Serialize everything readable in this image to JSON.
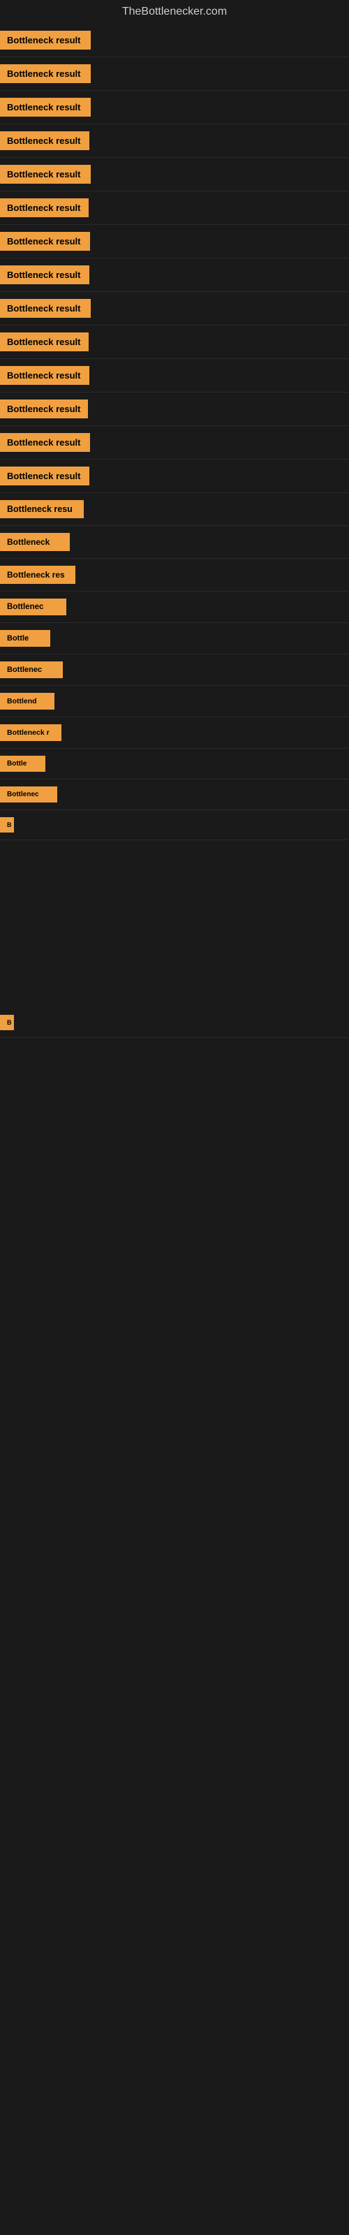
{
  "site": {
    "title": "TheBottlenecker.com"
  },
  "rows": [
    {
      "id": 1,
      "label": "Bottleneck result"
    },
    {
      "id": 2,
      "label": "Bottleneck result"
    },
    {
      "id": 3,
      "label": "Bottleneck result"
    },
    {
      "id": 4,
      "label": "Bottleneck result"
    },
    {
      "id": 5,
      "label": "Bottleneck result"
    },
    {
      "id": 6,
      "label": "Bottleneck result"
    },
    {
      "id": 7,
      "label": "Bottleneck result"
    },
    {
      "id": 8,
      "label": "Bottleneck result"
    },
    {
      "id": 9,
      "label": "Bottleneck result"
    },
    {
      "id": 10,
      "label": "Bottleneck result"
    },
    {
      "id": 11,
      "label": "Bottleneck result"
    },
    {
      "id": 12,
      "label": "Bottleneck result"
    },
    {
      "id": 13,
      "label": "Bottleneck result"
    },
    {
      "id": 14,
      "label": "Bottleneck result"
    },
    {
      "id": 15,
      "label": "Bottleneck resu"
    },
    {
      "id": 16,
      "label": "Bottleneck"
    },
    {
      "id": 17,
      "label": "Bottleneck res"
    },
    {
      "id": 18,
      "label": "Bottlenec"
    },
    {
      "id": 19,
      "label": "Bottle"
    },
    {
      "id": 20,
      "label": "Bottlenec"
    },
    {
      "id": 21,
      "label": "Bottlend"
    },
    {
      "id": 22,
      "label": "Bottleneck r"
    },
    {
      "id": 23,
      "label": "Bottle"
    },
    {
      "id": 24,
      "label": "Bottlenec"
    },
    {
      "id": 25,
      "label": "B"
    },
    {
      "id": 26,
      "label": ""
    },
    {
      "id": 27,
      "label": ""
    },
    {
      "id": 28,
      "label": ""
    },
    {
      "id": 29,
      "label": ""
    },
    {
      "id": 30,
      "label": "B"
    },
    {
      "id": 31,
      "label": ""
    },
    {
      "id": 32,
      "label": ""
    }
  ],
  "colors": {
    "badge_bg": "#f0a040",
    "badge_text": "#000000",
    "page_bg": "#1a1a1a",
    "title_color": "#cccccc"
  }
}
